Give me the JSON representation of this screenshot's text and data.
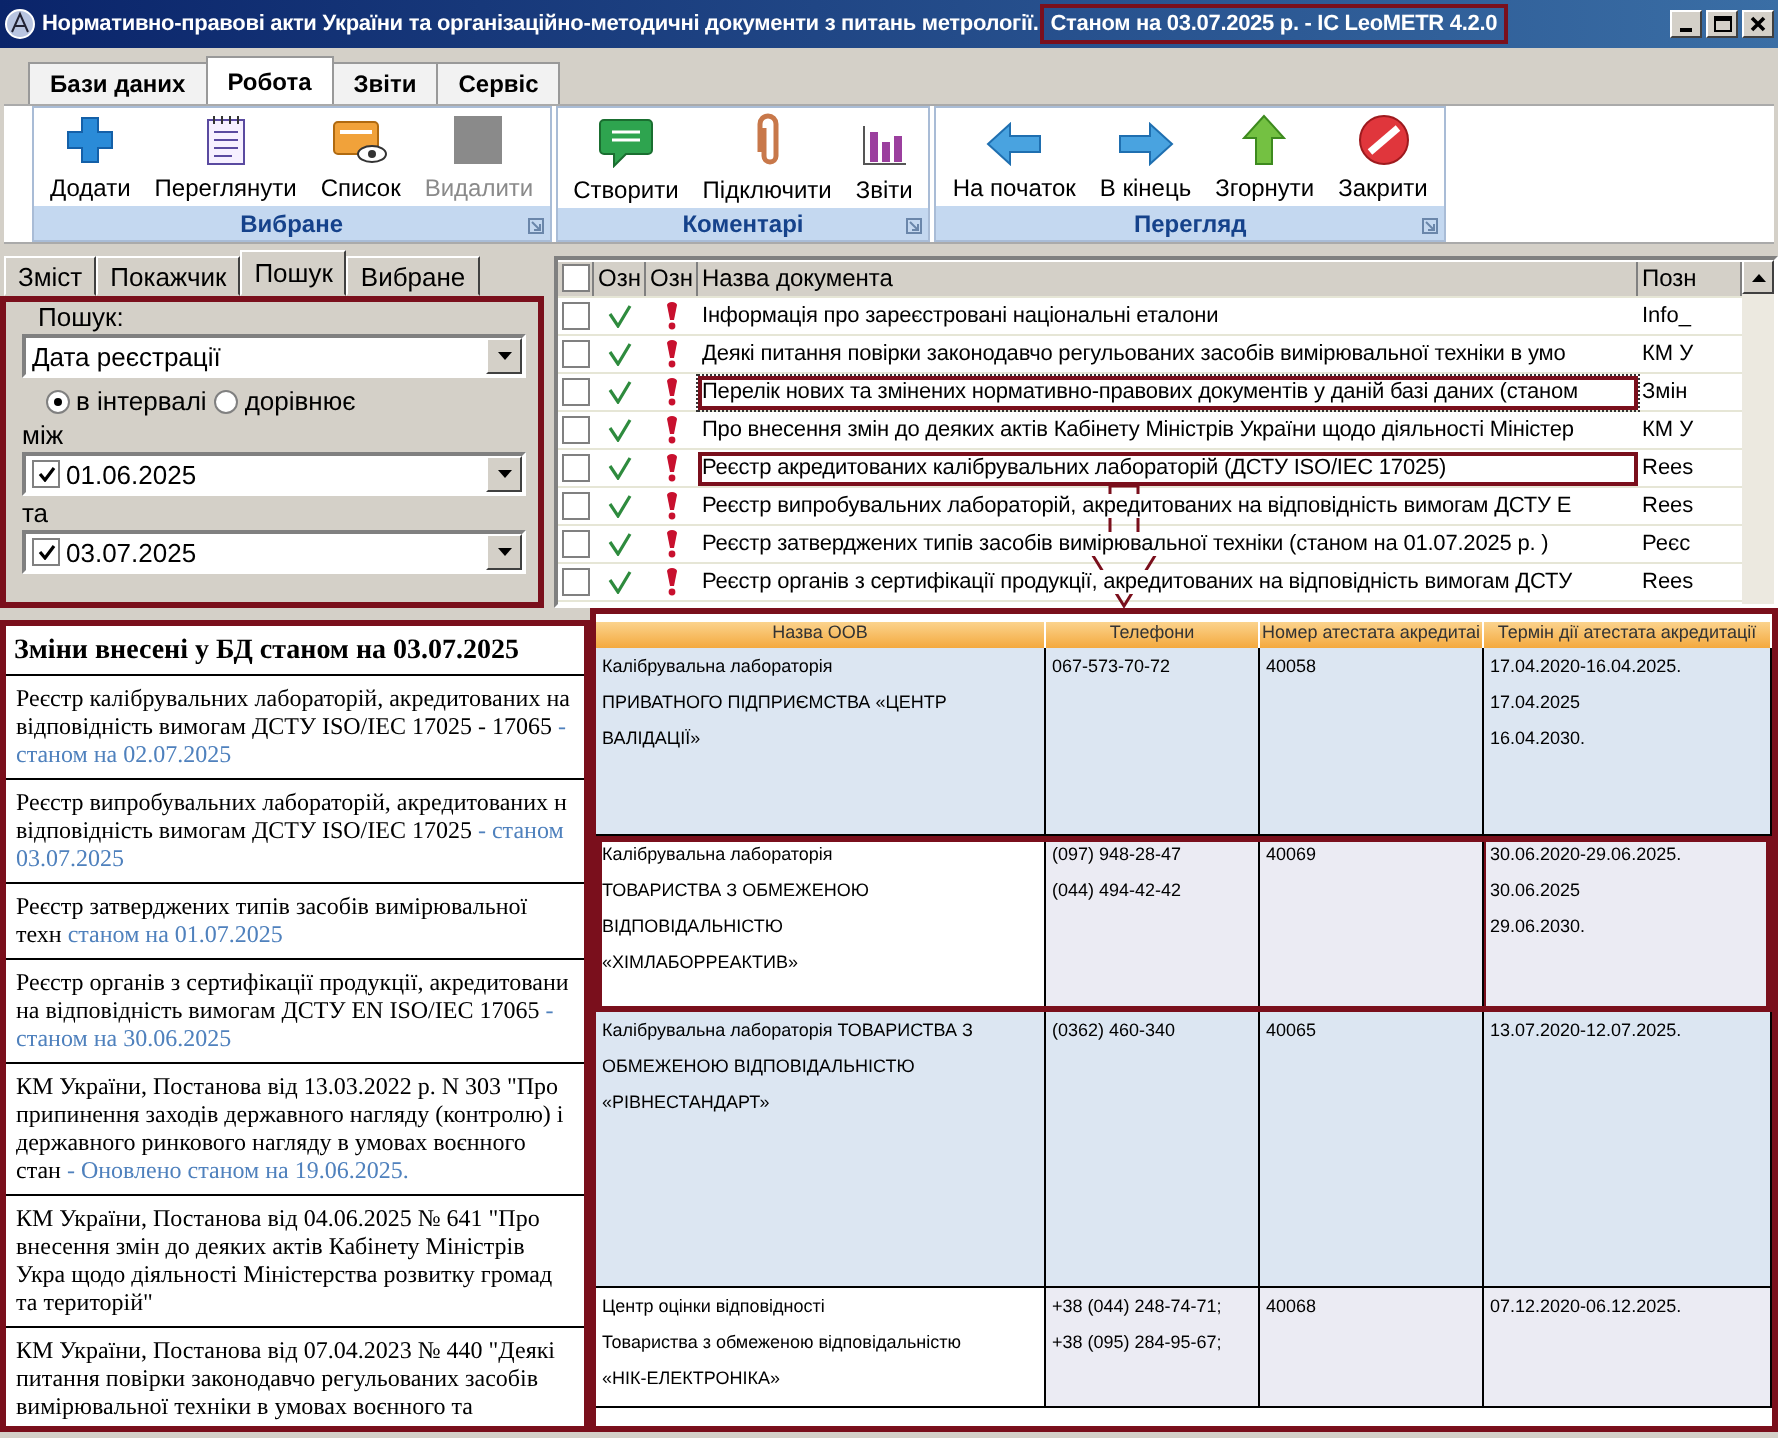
{
  "window": {
    "title": "Нормативно-правові акти України та організаційно-методичні документи з питань метрології.",
    "status": "Станом на 03.07.2025 р. - ІС LeoMETR 4.2.0",
    "status_outlined": true
  },
  "ribbon_tabs": [
    {
      "label": "Бази даних",
      "selected": false
    },
    {
      "label": "Робота",
      "selected": true
    },
    {
      "label": "Звіти",
      "selected": false
    },
    {
      "label": "Сервіс",
      "selected": false
    }
  ],
  "ribbon_groups": [
    {
      "title": "Вибране",
      "buttons": [
        {
          "label": "Додати",
          "disabled": false
        },
        {
          "label": "Переглянути",
          "disabled": false
        },
        {
          "label": "Список",
          "disabled": false
        },
        {
          "label": "Видалити",
          "disabled": true
        }
      ]
    },
    {
      "title": "Коментарі",
      "buttons": [
        {
          "label": "Створити",
          "disabled": false
        },
        {
          "label": "Підключити",
          "disabled": false
        },
        {
          "label": "Звіти",
          "disabled": false
        }
      ]
    },
    {
      "title": "Перегляд",
      "buttons": [
        {
          "label": "На початок",
          "disabled": false
        },
        {
          "label": "В кінець",
          "disabled": false
        },
        {
          "label": "Згорнути",
          "disabled": false
        },
        {
          "label": "Закрити",
          "disabled": false
        }
      ]
    }
  ],
  "side_tabs": [
    {
      "label": "Зміст",
      "selected": false
    },
    {
      "label": "Покажчик",
      "selected": false
    },
    {
      "label": "Пошук",
      "selected": true
    },
    {
      "label": "Вибране",
      "selected": false
    }
  ],
  "search": {
    "label": "Пошук:",
    "field": "Дата реєстрації",
    "modes": [
      {
        "label": "в інтервалі",
        "selected": true
      },
      {
        "label": "дорівнює",
        "selected": false
      }
    ],
    "from_label": "між",
    "from": {
      "value": "01.06.2025",
      "checked": true
    },
    "to_label": "та",
    "to": {
      "value": "03.07.2025",
      "checked": true
    }
  },
  "documents": {
    "all_checked": false,
    "columns": [
      "Озн",
      "Озн",
      "Назва документа",
      "Позн"
    ],
    "rows": [
      {
        "checked": false,
        "name": "Інформація про зареєстровані національні еталони",
        "code": "Info_",
        "selected": false,
        "outlined": false
      },
      {
        "checked": false,
        "name": "Деякі питання повірки законодавчо регульованих засобів вимірювальної техніки в умо",
        "code": "КМ У",
        "selected": false,
        "outlined": false
      },
      {
        "checked": false,
        "name": "Перелік нових та змінених нормативно-правових документів у даній базі даних (станом",
        "code": "Змін",
        "selected": true,
        "outlined": true
      },
      {
        "checked": false,
        "name": "Про внесення змін до деяких актів Кабінету Міністрів України щодо діяльності Міністер",
        "code": "КМ У",
        "selected": false,
        "outlined": false
      },
      {
        "checked": false,
        "name": "Реєстр акредитованих калібрувальних лабораторій (ДСТУ ISO/IEC 17025)",
        "code": "Rees",
        "selected": false,
        "outlined": true
      },
      {
        "checked": false,
        "name": "Реєстр випробувальних лабораторій, акредитованих на відповідність вимогам ДСТУ Е",
        "code": "Rees",
        "selected": false,
        "outlined": false
      },
      {
        "checked": false,
        "name": "Реєстр затверджених типів засобів вимірювальної техніки  (станом на 01.07.2025 р. )",
        "code": "Реєс",
        "selected": false,
        "outlined": false
      },
      {
        "checked": false,
        "name": "Реєстр органів з сертифікації продукції, акредитованих на відповідність вимогам ДСТУ",
        "code": "Rees",
        "selected": false,
        "outlined": false
      }
    ]
  },
  "changes": {
    "title": "Зміни внесені у БД станом на 03.07.2025",
    "entries": [
      {
        "text": "Реєстр калібрувальних лабораторій, акредитованих на відповідність вимогам ДСТУ ISO/IEC 17025 - 17065",
        "note": "- станом на 02.07.2025"
      },
      {
        "text": "Реєстр випробувальних лабораторій, акредитованих н відповідність вимогам ДСТУ ISO/IEC 17025",
        "note": "- станом 03.07.2025"
      },
      {
        "text": "Реєстр затверджених типів засобів вимірювальної техн",
        "note": "станом на 01.07.2025"
      },
      {
        "text": "Реєстр органів з сертифікації продукції, акредитовани на відповідність вимогам ДСТУ EN ISO/IEC 17065",
        "note": "- станом на 30.06.2025"
      },
      {
        "text": "КМ України, Постанова від 13.03.2022 р. N 303 \"Про припинення заходів державного нагляду (контролю) і державного ринкового нагляду в умовах воєнного стан",
        "note": "- Оновлено станом на 19.06.2025."
      },
      {
        "text": "КМ України, Постанова від 04.06.2025 № 641 \"Про внесення змін до деяких актів Кабінету Міністрів Укра щодо діяльності Міністерства розвитку громад та територій\""
      },
      {
        "text": "КМ України, Постанова від 07.04.2023 № 440 \"Деякі питання повірки законодавчо регульованих засобів вимірювальної техніки в умовах воєнного та"
      }
    ]
  },
  "registry": {
    "columns": [
      "Назва ООВ",
      "Телефони",
      "Номер атестата акредитаі",
      "Термін дії атестата акредитації"
    ],
    "rows": [
      {
        "cells": [
          "Калібрувальна лабораторія\nПРИВАТНОГО ПІДПРИЄМСТВА «ЦЕНТР ВАЛІДАЦІЇ»",
          "067-573-70-72",
          "40058",
          "17.04.2020-16.04.2025. 17.04.2025\n16.04.2030."
        ],
        "outlined": false,
        "date_outlined": false
      },
      {
        "cells": [
          "Калібрувальна лабораторія\nТОВАРИСТВА З ОБМЕЖЕНОЮ ВІДПОВІДАЛЬНІСТЮ\n«ХІМЛАБОРРЕАКТИВ»",
          "(097) 948-28-47\n(044) 494-42-42",
          "40069",
          "30.06.2020-29.06.2025. 30.06.2025\n29.06.2030."
        ],
        "outlined": true,
        "date_outlined": true
      },
      {
        "cells": [
          "Калібрувальна лабораторія ТОВАРИСТВА З\nОБМЕЖЕНОЮ ВІДПОВІДАЛЬНІСТЮ\n«РІВНЕСТАНДАРТ»",
          "(0362) 460-340",
          "40065",
          "13.07.2020-12.07.2025."
        ],
        "outlined": false,
        "date_outlined": false
      },
      {
        "cells": [
          "Центр оцінки відповідності\nТовариства з обмеженою відповідальністю\n«НІК-ЕЛЕКТРОНІКА»",
          "+38 (044) 248-74-71;\n+38 (095) 284-95-67;",
          "40068",
          "07.12.2020-06.12.2025."
        ],
        "outlined": false,
        "date_outlined": false
      }
    ]
  }
}
